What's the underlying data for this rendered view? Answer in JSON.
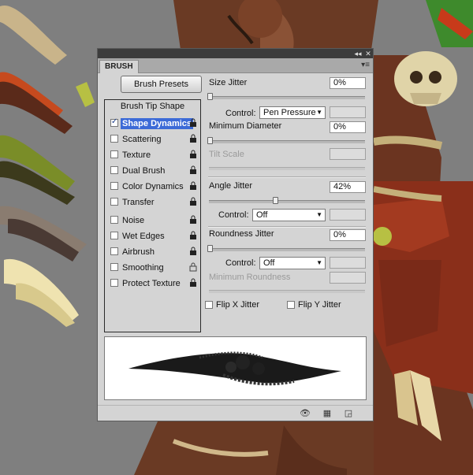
{
  "panel": {
    "tab_label": "BRUSH",
    "collapse_icon": "double-arrow-icon",
    "close_icon": "close-icon",
    "menu_icon": "panel-menu-icon"
  },
  "presets_button": "Brush Presets",
  "list": {
    "header": "Brush Tip Shape",
    "items": [
      {
        "label": "Shape Dynamics",
        "checked": true,
        "selected": true
      },
      {
        "label": "Scattering",
        "checked": false
      },
      {
        "label": "Texture",
        "checked": false
      },
      {
        "label": "Dual Brush",
        "checked": false
      },
      {
        "label": "Color Dynamics",
        "checked": false
      },
      {
        "label": "Transfer",
        "checked": false
      },
      {
        "label": "Noise",
        "checked": false
      },
      {
        "label": "Wet Edges",
        "checked": false
      },
      {
        "label": "Airbrush",
        "checked": false
      },
      {
        "label": "Smoothing",
        "checked": false
      },
      {
        "label": "Protect Texture",
        "checked": false
      }
    ]
  },
  "controls": {
    "size_jitter": {
      "label": "Size Jitter",
      "value": "0%"
    },
    "control1": {
      "label": "Control:",
      "value": "Pen Pressure"
    },
    "min_diameter": {
      "label": "Minimum Diameter",
      "value": "0%"
    },
    "tilt_scale": {
      "label": "Tilt Scale"
    },
    "angle_jitter": {
      "label": "Angle Jitter",
      "value": "42%",
      "level": 0.42
    },
    "control2": {
      "label": "Control:",
      "value": "Off"
    },
    "roundness_jitter": {
      "label": "Roundness Jitter",
      "value": "0%"
    },
    "control3": {
      "label": "Control:",
      "value": "Off"
    },
    "min_roundness": {
      "label": "Minimum Roundness"
    },
    "flip_x": "Flip X Jitter",
    "flip_y": "Flip Y Jitter"
  },
  "bottom_icons": [
    "eye-brush-icon",
    "grid-icon",
    "new-preset-icon"
  ]
}
